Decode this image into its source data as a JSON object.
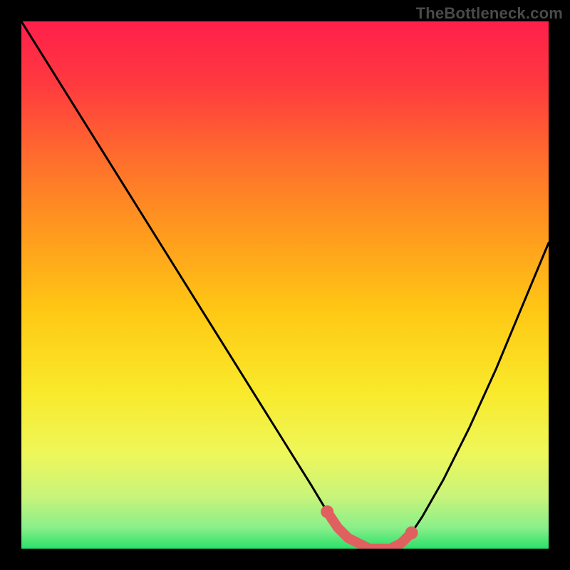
{
  "watermark": "TheBottleneck.com",
  "chart_data": {
    "type": "line",
    "title": "",
    "xlabel": "",
    "ylabel": "",
    "xlim": [
      0,
      100
    ],
    "ylim": [
      0,
      100
    ],
    "x": [
      0,
      5,
      10,
      15,
      20,
      25,
      30,
      35,
      40,
      45,
      50,
      55,
      58,
      60,
      62,
      64,
      66,
      68,
      70,
      72,
      74,
      76,
      80,
      85,
      90,
      95,
      100
    ],
    "values": [
      100,
      92,
      84,
      76,
      68,
      60,
      52,
      44,
      36,
      28,
      20,
      12,
      7,
      4,
      2,
      1,
      0,
      0,
      0,
      1,
      3,
      6,
      13,
      23,
      34,
      46,
      58
    ],
    "gradient_stops": [
      {
        "offset": 0.0,
        "color": "#ff1f4b"
      },
      {
        "offset": 0.12,
        "color": "#ff3a3f"
      },
      {
        "offset": 0.25,
        "color": "#ff6a2e"
      },
      {
        "offset": 0.4,
        "color": "#ff9a1e"
      },
      {
        "offset": 0.55,
        "color": "#ffc814"
      },
      {
        "offset": 0.7,
        "color": "#f9e92a"
      },
      {
        "offset": 0.82,
        "color": "#eef75a"
      },
      {
        "offset": 0.9,
        "color": "#c9f47a"
      },
      {
        "offset": 0.96,
        "color": "#8aef8a"
      },
      {
        "offset": 1.0,
        "color": "#2be06a"
      }
    ],
    "marker_segment": {
      "color": "#e06060",
      "points_x": [
        58,
        60,
        62,
        64,
        66,
        68,
        70,
        72,
        74
      ],
      "points_y": [
        7,
        4,
        2,
        1,
        0,
        0,
        0,
        1,
        3
      ]
    }
  }
}
